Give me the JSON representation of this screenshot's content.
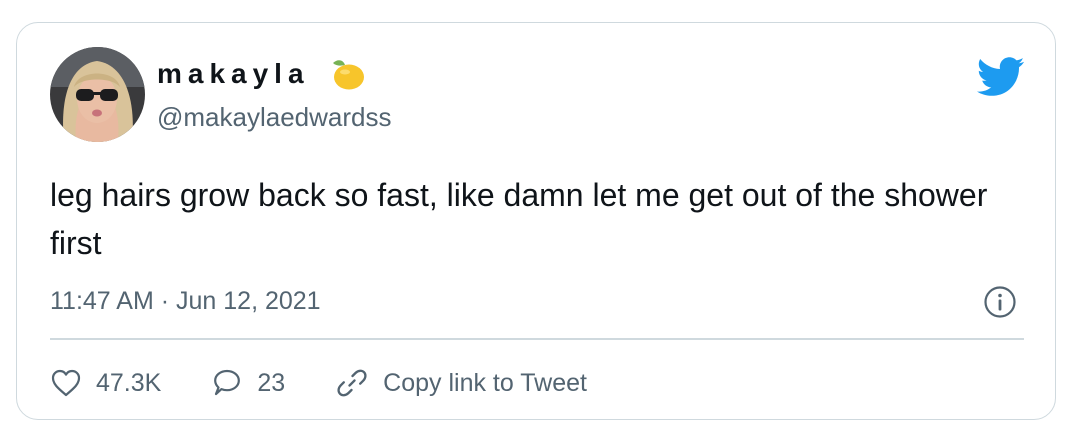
{
  "tweet": {
    "display_name": "makayla",
    "name_emoji": "lemon-icon",
    "handle": "@makaylaedwardss",
    "text": "leg hairs grow back so fast, like damn let me get out of the shower first",
    "time": "11:47 AM",
    "separator": "·",
    "date": "Jun 12, 2021"
  },
  "actions": {
    "likes": "47.3K",
    "replies": "23",
    "copy_link_label": "Copy link to Tweet"
  },
  "colors": {
    "brand_blue": "#1d9bf0",
    "text_primary": "#0f1419",
    "text_secondary": "#536471",
    "border": "#cfd9de",
    "lemon": "#f7c52b"
  }
}
